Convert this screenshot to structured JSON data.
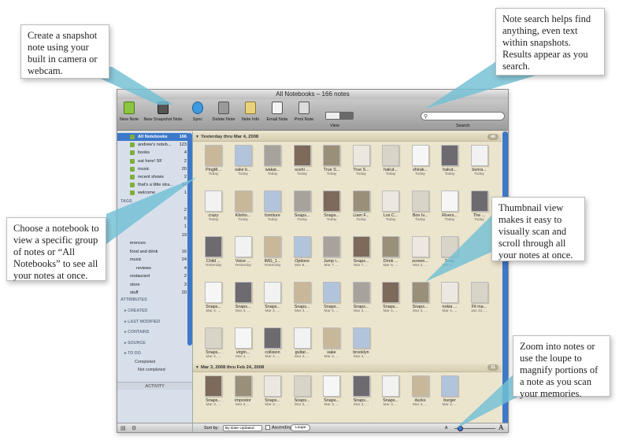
{
  "window": {
    "title": "All Notebooks – 166 notes"
  },
  "toolbar": {
    "new_note": "New Note",
    "new_snapshot": "New Snapshot Note",
    "sync": "Sync",
    "delete_note": "Delete Note",
    "note_info": "Note Info",
    "email_note": "Email Note",
    "print_note": "Print Note",
    "view": "View",
    "search": "Search"
  },
  "sidebar": {
    "notebooks": [
      {
        "name": "All Notebooks",
        "count": "166",
        "selected": true
      },
      {
        "name": "andrew's noteb...",
        "count": "123"
      },
      {
        "name": "books",
        "count": "4"
      },
      {
        "name": "eat here! SF",
        "count": "2"
      },
      {
        "name": "music",
        "count": "20"
      },
      {
        "name": "recent shows",
        "count": "2"
      },
      {
        "name": "that's a little stra...",
        "count": "14"
      },
      {
        "name": "welcome",
        "count": "1"
      }
    ],
    "tags_header": "TAGS",
    "tags": [
      {
        "name": "",
        "count": "2"
      },
      {
        "name": "",
        "count": "6"
      },
      {
        "name": "",
        "count": "1"
      },
      {
        "name": "",
        "count": "19"
      },
      {
        "name": "erences",
        "count": ""
      },
      {
        "name": "food and drink",
        "count": "16"
      },
      {
        "name": "music",
        "count": "24"
      },
      {
        "name": "reviews",
        "count": "4"
      },
      {
        "name": "restaurant",
        "count": "2"
      },
      {
        "name": "store",
        "count": "3"
      },
      {
        "name": "stuff",
        "count": "20"
      }
    ],
    "attributes_header": "ATTRIBUTES",
    "attributes": [
      "CREATED",
      "LAST MODIFIED",
      "CONTAINS",
      "SOURCE",
      "TO DO"
    ],
    "todo": [
      "Completed",
      "Not completed"
    ],
    "activity": "ACTIVITY"
  },
  "groups": [
    {
      "label": "Yesterday thru Mar 4, 2008",
      "count": "46",
      "rows": [
        [
          {
            "title": "PingM...",
            "date": "Today"
          },
          {
            "title": "sake b...",
            "date": "Today"
          },
          {
            "title": "wakat...",
            "date": "Today"
          },
          {
            "title": "sushi ...",
            "date": "Today"
          },
          {
            "title": "True S...",
            "date": "Today"
          },
          {
            "title": "True S...",
            "date": "Today"
          },
          {
            "title": "hakut...",
            "date": "Today"
          },
          {
            "title": "shirak...",
            "date": "Today"
          },
          {
            "title": "hakut...",
            "date": "Today"
          },
          {
            "title": "bunra...",
            "date": "Today"
          }
        ],
        [
          {
            "title": "crazy",
            "date": "Today"
          },
          {
            "title": "Kitsho...",
            "date": "Today"
          },
          {
            "title": "furniture",
            "date": "Today"
          },
          {
            "title": "Snaps...",
            "date": "Today"
          },
          {
            "title": "Snaps...",
            "date": "Today"
          },
          {
            "title": "Liam F...",
            "date": "Today"
          },
          {
            "title": "Los C...",
            "date": "Today"
          },
          {
            "title": "Bon Iv...",
            "date": "Today"
          },
          {
            "title": "Rivers...",
            "date": "Today"
          },
          {
            "title": "The ...",
            "date": "Today"
          }
        ],
        [
          {
            "title": "Child ...",
            "date": "Yesterday"
          },
          {
            "title": "Voice ...",
            "date": "Yesterday"
          },
          {
            "title": "IMG_1...",
            "date": "Yesterday"
          },
          {
            "title": "Options",
            "date": "Mar 8, ..."
          },
          {
            "title": "Jump i...",
            "date": "Mar 7, ..."
          },
          {
            "title": "Snaps...",
            "date": "Mar 7, ..."
          },
          {
            "title": "Drink ...",
            "date": "Mar 6, ..."
          },
          {
            "title": "screen...",
            "date": "Mar 4, ..."
          },
          {
            "title": "Snap",
            "date": "Mar 4, ..."
          }
        ],
        [
          {
            "title": "Snaps...",
            "date": "Mar 4, ..."
          },
          {
            "title": "Snaps...",
            "date": "Mar 4, ..."
          },
          {
            "title": "Snaps...",
            "date": "Mar 4, ..."
          },
          {
            "title": "Snaps...",
            "date": "Mar 4, ..."
          },
          {
            "title": "Snaps...",
            "date": "Mar 4, ..."
          },
          {
            "title": "Snaps...",
            "date": "Mar 4, ..."
          },
          {
            "title": "Snaps...",
            "date": "Mar 4, ..."
          },
          {
            "title": "Snaps...",
            "date": "Mar 4, ..."
          },
          {
            "title": "nokia ...",
            "date": "Mar 4, ..."
          },
          {
            "title": "Fit ma...",
            "date": "Jan 22, ..."
          }
        ],
        [
          {
            "title": "Snaps...",
            "date": "Mar 4, ..."
          },
          {
            "title": "virgin...",
            "date": "Mar 4, ..."
          },
          {
            "title": "collision",
            "date": "Mar 4, ..."
          },
          {
            "title": "guitar...",
            "date": "Mar 4, ..."
          },
          {
            "title": "sake",
            "date": "Mar 4, ..."
          },
          {
            "title": "brooklyn",
            "date": "Mar 4, ..."
          }
        ]
      ]
    },
    {
      "label": "Mar 3, 2008 thru Feb 24, 2008",
      "count": "31",
      "rows": [
        [
          {
            "title": "Snaps...",
            "date": "Mar 3, ..."
          },
          {
            "title": "impostor",
            "date": "Mar 3, ..."
          },
          {
            "title": "Snaps...",
            "date": "Mar 3, ..."
          },
          {
            "title": "Snaps...",
            "date": "Mar 3, ..."
          },
          {
            "title": "Snaps...",
            "date": "Mar 3, ..."
          },
          {
            "title": "Snaps...",
            "date": "Mar 3, ..."
          },
          {
            "title": "Snaps...",
            "date": "Mar 3, ..."
          },
          {
            "title": "ducks",
            "date": "Mar 3, ..."
          },
          {
            "title": "burger",
            "date": "Mar 3, ..."
          }
        ]
      ]
    }
  ],
  "footer": {
    "sort_by": "Sort by:",
    "sort_value": "By Date Updated",
    "ascending": "Ascending",
    "loupe": "Loupe",
    "zoom_small": "A",
    "zoom_large": "A"
  },
  "callouts": {
    "snapshot": "Create a snapshot note using your built in camera or webcam.",
    "search": "Note search helps find anything, even text within snapshots. Results appear as you search.",
    "notebook": "Choose a notebook to view a specific group of notes or “All Notebooks” to see all your notes at once.",
    "thumbnail": "Thumbnail view makes it easy to visually scan and scroll through all your notes at once.",
    "zoom": "Zoom into notes or use the loupe to magnify portions of a note as you scan your memories."
  },
  "colors": {
    "accent": "#3d78c9",
    "callout_beam": "#72c0d4",
    "grid_bg": "#ece5ce",
    "sidebar_bg": "#d7dfeb"
  }
}
